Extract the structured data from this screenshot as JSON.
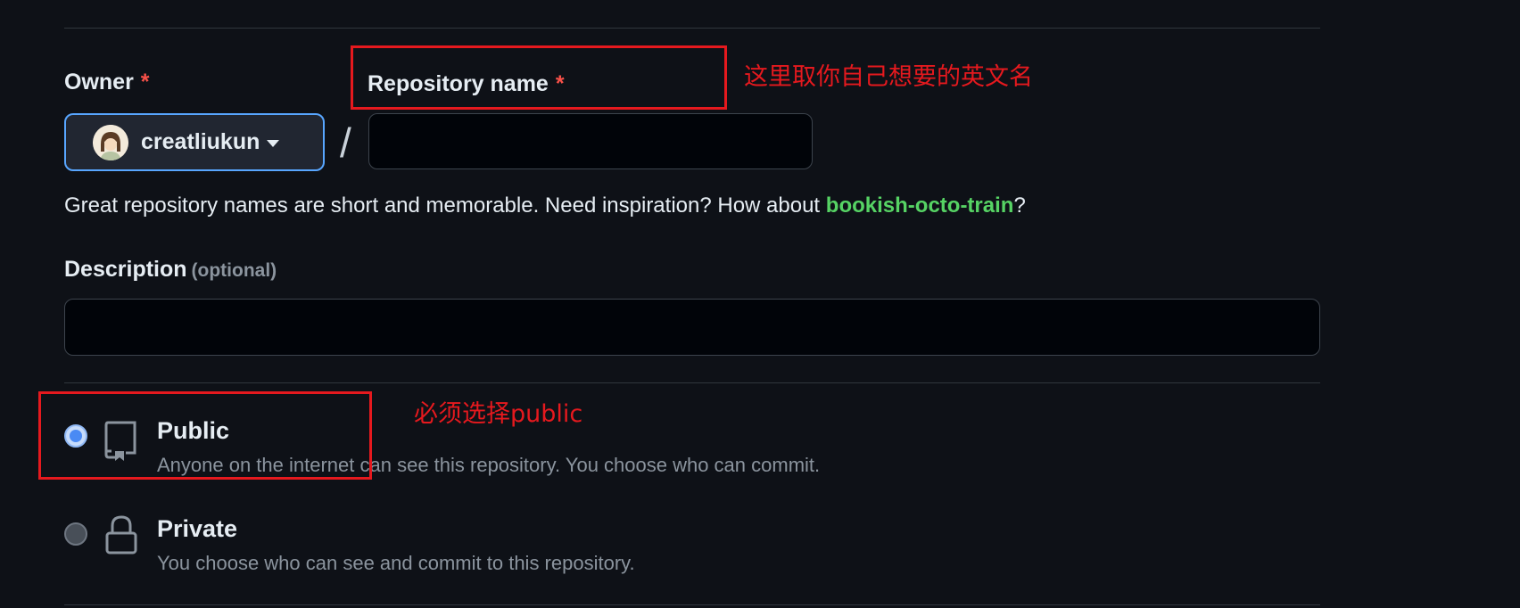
{
  "form": {
    "owner_label": "Owner",
    "required_mark": "*",
    "repo_name_label": "Repository name",
    "owner_value": "creatliukun",
    "slash": "/",
    "repo_name_value": "",
    "help_prefix": "Great repository names are short and memorable. Need inspiration? How about ",
    "help_suggestion": "bookish-octo-train",
    "help_suffix": "?",
    "description_label": "Description",
    "description_optional": "(optional)",
    "description_value": ""
  },
  "visibility": {
    "options": [
      {
        "title": "Public",
        "description": "Anyone on the internet can see this repository. You choose who can commit.",
        "selected": true,
        "icon": "repo-icon"
      },
      {
        "title": "Private",
        "description": "You choose who can see and commit to this repository.",
        "selected": false,
        "icon": "lock-icon"
      }
    ]
  },
  "annotations": {
    "repo_name_note": "这里取你自己想要的英文名",
    "public_note": "必须选择public"
  },
  "colors": {
    "background": "#0e1117",
    "accent_blue": "#58a6ff",
    "suggestion_green": "#56d364",
    "required_red": "#f85149",
    "annotation_red": "#e5191e"
  }
}
